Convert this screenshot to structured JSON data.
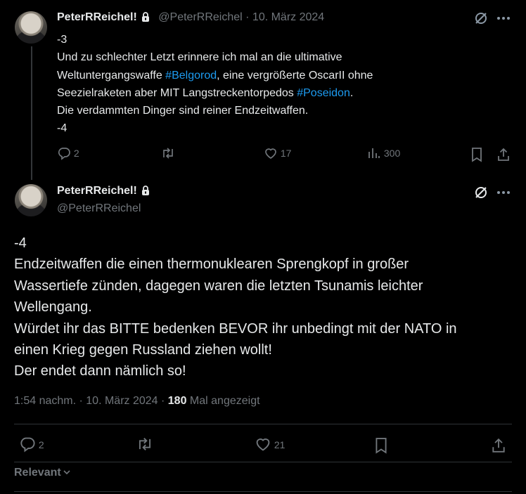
{
  "tweet1": {
    "name": "PeterRReichel!",
    "handle": "@PeterRReichel",
    "date": "· 10. März 2024",
    "text_before_1": "-3\nUnd zu schlechter Letzt erinnere ich mal an die ultimative\nWeltuntergangswaffe ",
    "hashtag_1": "#Belgorod",
    "text_between": ", eine vergrößerte OscarII ohne\nSeezielraketen aber MIT Langstreckentorpedos ",
    "hashtag_2": "#Poseidon",
    "text_after": ".\nDie verdammten Dinger sind reiner Endzeitwaffen.\n-4",
    "replies": "2",
    "likes": "17",
    "views": "300"
  },
  "tweet2": {
    "name": "PeterRReichel!",
    "handle": "@PeterRReichel",
    "text": "-4\nEndzeitwaffen die einen thermonuklearen Sprengkopf in großer\nWassertiefe zünden, dagegen waren die letzten Tsunamis leichter\nWellengang.\nWürdet ihr das BITTE bedenken BEVOR ihr unbedingt mit der NATO in\neinen Krieg gegen Russland ziehen wollt!\nDer endet dann nämlich so!",
    "time": "1:54 nachm. · 10. März 2024 · ",
    "views_count": "180",
    "views_label": " Mal angezeigt",
    "replies": "2",
    "likes": "21"
  },
  "footer": {
    "sort_label": "Relevant"
  },
  "colors": {
    "accent": "#1d9bf0",
    "muted": "#71767b",
    "text": "#e7e9ea",
    "bg": "#000000"
  }
}
